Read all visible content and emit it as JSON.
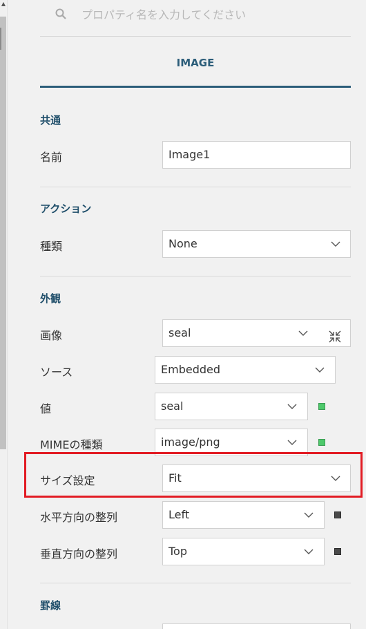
{
  "search": {
    "placeholder": "プロパティ名を入力してください"
  },
  "tab": {
    "title": "IMAGE"
  },
  "sections": {
    "common": {
      "title": "共通",
      "name_label": "名前",
      "name_value": "Image1"
    },
    "action": {
      "title": "アクション",
      "type_label": "種類",
      "type_value": "None"
    },
    "appearance": {
      "title": "外観",
      "image_label": "画像",
      "image_value": "seal",
      "source_label": "ソース",
      "source_value": "Embedded",
      "value_label": "値",
      "value_value": "seal",
      "mime_label": "MIMEの種類",
      "mime_value": "image/png",
      "size_label": "サイズ設定",
      "size_value": "Fit",
      "halign_label": "水平方向の整列",
      "halign_value": "Left",
      "valign_label": "垂直方向の整列",
      "valign_value": "Top"
    },
    "border": {
      "title": "罫線"
    }
  },
  "colors": {
    "accent": "#2b5d79",
    "highlight": "#e21b23",
    "status_green": "#4ec96b",
    "status_gray": "#4a4a4a"
  },
  "icons": {
    "search": "search-icon",
    "dropdown": "chevron-down-icon",
    "shrink": "shrink-icon",
    "scroll_up": "triangle-up-icon"
  }
}
